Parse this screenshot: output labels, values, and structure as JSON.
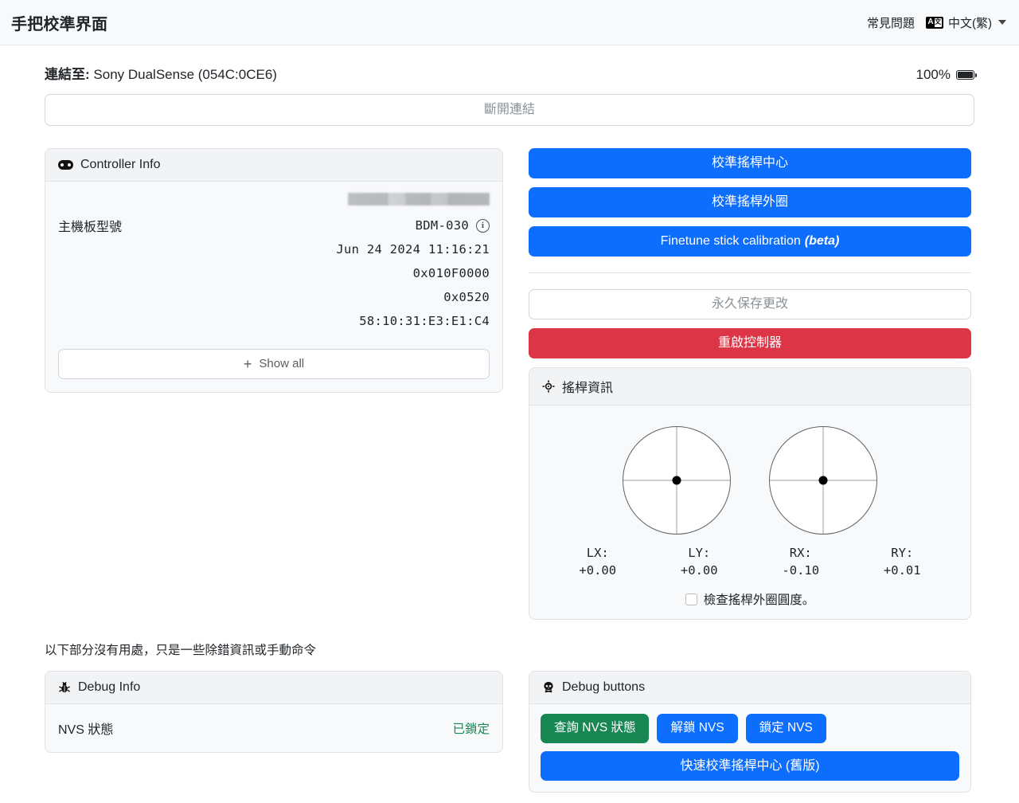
{
  "navbar": {
    "title": "手把校準界面",
    "faq_label": "常見問題",
    "language_label": "中文(繁)",
    "translate_icon_a": "A",
    "translate_icon_z": "文"
  },
  "connection": {
    "prefix": "連結至:",
    "device": " Sony DualSense (054C:0CE6)",
    "battery_percent": "100%",
    "disconnect_label": "斷開連結"
  },
  "controller_info": {
    "header": "Controller Info",
    "rows": [
      {
        "label": "主機板型號",
        "value": "BDM-030",
        "has_info_icon": true
      },
      {
        "label": "",
        "value": "Jun 24 2024 11:16:21",
        "has_info_icon": false
      },
      {
        "label": "",
        "value": "0x010F0000",
        "has_info_icon": false
      },
      {
        "label": "",
        "value": "0x0520",
        "has_info_icon": false
      },
      {
        "label": "",
        "value": "58:10:31:E3:E1:C4",
        "has_info_icon": false
      }
    ],
    "show_all_label": "Show all",
    "show_all_plus": "+"
  },
  "actions": {
    "calibrate_center": "校準搖桿中心",
    "calibrate_range": "校準搖桿外圈",
    "finetune_main": "Finetune stick calibration",
    "finetune_beta": "(beta)",
    "save_permanently": "永久保存更改",
    "reboot_controller": "重啟控制器"
  },
  "stick_info": {
    "header": "搖桿資訊",
    "axes": [
      {
        "name": "LX:",
        "value": "+0.00"
      },
      {
        "name": "LY:",
        "value": "+0.00"
      },
      {
        "name": "RX:",
        "value": "-0.10"
      },
      {
        "name": "RY:",
        "value": "+0.01"
      }
    ],
    "checkbox_label": "檢查搖桿外圈圓度。",
    "checkbox_checked": false
  },
  "debug": {
    "note": "以下部分沒有用處，只是一些除錯資訊或手動命令",
    "info_header": "Debug Info",
    "nvs_label": "NVS 狀態",
    "nvs_status": "已鎖定",
    "buttons_header": "Debug buttons",
    "query_nvs": "查詢 NVS 狀態",
    "unlock_nvs": "解鎖 NVS",
    "lock_nvs": "鎖定 NVS",
    "quick_center": "快速校準搖桿中心 (舊版)"
  },
  "colors": {
    "primary": "#0d6efd",
    "danger": "#dc3545",
    "success": "#198754",
    "navbar_bg": "#f8f9fa",
    "card_bg": "#f8f9fb"
  }
}
